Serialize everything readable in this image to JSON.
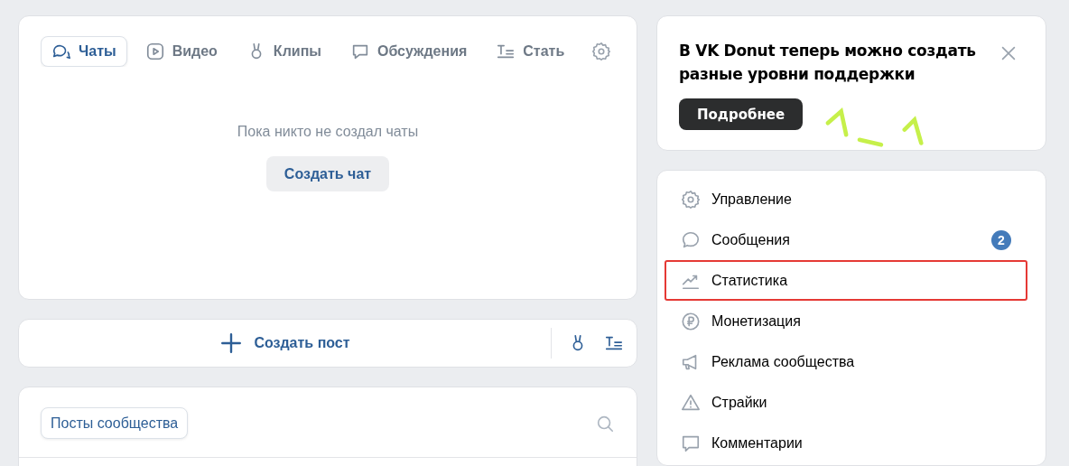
{
  "tabs": [
    {
      "label": "Чаты",
      "selected": true
    },
    {
      "label": "Видео",
      "selected": false
    },
    {
      "label": "Клипы",
      "selected": false
    },
    {
      "label": "Обсуждения",
      "selected": false
    },
    {
      "label": "Стать",
      "selected": false
    }
  ],
  "empty_text": "Пока никто не создал чаты",
  "create_chat_button": "Создать чат",
  "create_post_button": "Создать пост",
  "posts_filter": "Посты сообщества",
  "banner": {
    "title": "В VK Donut теперь можно создать разные уровни поддержки",
    "button": "Подробнее"
  },
  "menu": [
    {
      "label": "Управление",
      "highlighted": false
    },
    {
      "label": "Сообщения",
      "highlighted": false,
      "badge": "2"
    },
    {
      "label": "Статистика",
      "highlighted": true
    },
    {
      "label": "Монетизация",
      "highlighted": false
    },
    {
      "label": "Реклама сообщества",
      "highlighted": false
    },
    {
      "label": "Страйки",
      "highlighted": false
    },
    {
      "label": "Комментарии",
      "highlighted": false
    }
  ]
}
